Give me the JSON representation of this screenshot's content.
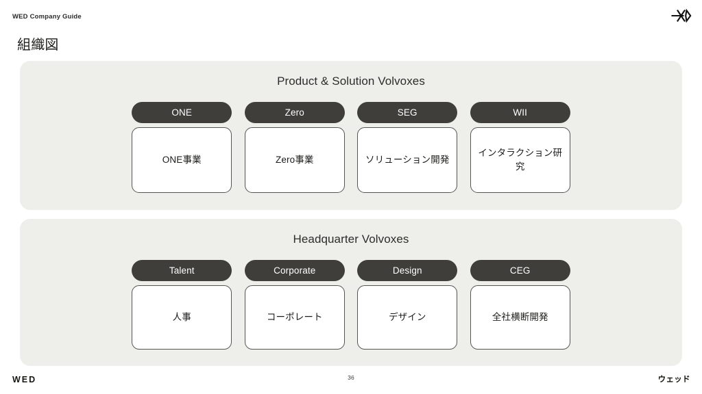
{
  "header": {
    "eyebrow": "WED Company Guide",
    "logo_icon": "wed-arrow-diamond-logo"
  },
  "page_title": "組織図",
  "sections": [
    {
      "title": "Product & Solution Volvoxes",
      "columns": [
        {
          "chip": "ONE",
          "card": "ONE事業"
        },
        {
          "chip": "Zero",
          "card": "Zero事業"
        },
        {
          "chip": "SEG",
          "card": "ソリューション開発"
        },
        {
          "chip": "WII",
          "card": "インタラクション研究"
        }
      ]
    },
    {
      "title": "Headquarter Volvoxes",
      "columns": [
        {
          "chip": "Talent",
          "card": "人事"
        },
        {
          "chip": "Corporate",
          "card": "コーポレート"
        },
        {
          "chip": "Design",
          "card": "デザイン"
        },
        {
          "chip": "CEG",
          "card": "全社横断開発"
        }
      ]
    }
  ],
  "footer": {
    "left": "WED",
    "page_number": "36",
    "right": "ウェッド"
  },
  "colors": {
    "panel_bg": "#eeeeea",
    "chip_bg": "#403e3b",
    "card_bg": "#ffffff",
    "card_border": "#55534f",
    "text": "#1c1c1a",
    "page_bg": "#ffffff"
  }
}
